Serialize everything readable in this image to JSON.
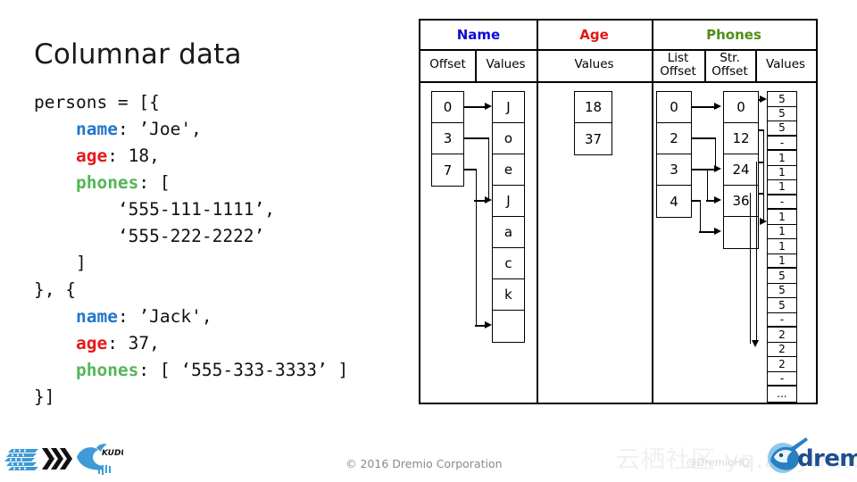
{
  "slide": {
    "title": "Columnar data"
  },
  "code": {
    "lines": [
      [
        {
          "t": "persons = [{",
          "c": "plain"
        }
      ],
      [
        {
          "t": "    ",
          "c": "plain"
        },
        {
          "t": "name",
          "c": "k-name"
        },
        {
          "t": ": ’Joe',",
          "c": "plain"
        }
      ],
      [
        {
          "t": "    ",
          "c": "plain"
        },
        {
          "t": "age",
          "c": "k-age"
        },
        {
          "t": ": 18,",
          "c": "plain"
        }
      ],
      [
        {
          "t": "    ",
          "c": "plain"
        },
        {
          "t": "phones",
          "c": "k-phone"
        },
        {
          "t": ": [",
          "c": "plain"
        }
      ],
      [
        {
          "t": "        ‘555-111-1111’,",
          "c": "plain"
        }
      ],
      [
        {
          "t": "        ‘555-222-2222’",
          "c": "plain"
        }
      ],
      [
        {
          "t": "    ]",
          "c": "plain"
        }
      ],
      [
        {
          "t": "}, {",
          "c": "plain"
        }
      ],
      [
        {
          "t": "    ",
          "c": "plain"
        },
        {
          "t": "name",
          "c": "k-name"
        },
        {
          "t": ": ’Jack',",
          "c": "plain"
        }
      ],
      [
        {
          "t": "    ",
          "c": "plain"
        },
        {
          "t": "age",
          "c": "k-age"
        },
        {
          "t": ": 37,",
          "c": "plain"
        }
      ],
      [
        {
          "t": "    ",
          "c": "plain"
        },
        {
          "t": "phones",
          "c": "k-phone"
        },
        {
          "t": ": [ ‘555-333-3333’ ]",
          "c": "plain"
        }
      ],
      [
        {
          "t": "}]",
          "c": "plain"
        }
      ]
    ]
  },
  "diagram": {
    "group_headers": [
      {
        "label": "Name",
        "color": "#0b0bd6"
      },
      {
        "label": "Age",
        "color": "#e11717"
      },
      {
        "label": "Phones",
        "color": "#4f8f13"
      }
    ],
    "sub_headers": [
      {
        "label": "Offset"
      },
      {
        "label": "Values"
      },
      {
        "label": "Values"
      },
      {
        "label": "List\nOffset"
      },
      {
        "label": "Str.\nOffset"
      },
      {
        "label": "Values"
      }
    ],
    "name_offsets": [
      "0",
      "3",
      "7"
    ],
    "name_values": [
      "J",
      "o",
      "e",
      "J",
      "a",
      "c",
      "k",
      ""
    ],
    "age_values": [
      "18",
      "37"
    ],
    "phones_list_offsets": [
      "0",
      "2",
      "3",
      "4"
    ],
    "phones_str_offsets": [
      "0",
      "12",
      "24",
      "36",
      ""
    ],
    "phones_values": [
      "5",
      "5",
      "5",
      "-",
      "1",
      "1",
      "1",
      "-",
      "1",
      "1",
      "1",
      "1",
      "5",
      "5",
      "5",
      "-",
      "2",
      "2",
      "2",
      "-",
      "..."
    ],
    "phones_values_group_breaks": [
      2,
      3,
      6,
      7,
      11,
      15,
      19
    ]
  },
  "footer": {
    "copyright": "© 2016 Dremio Corporation",
    "handle": "@DremioHQ",
    "watermark": "云栖社区 yq.aliyun.com",
    "brand": "dremio"
  }
}
